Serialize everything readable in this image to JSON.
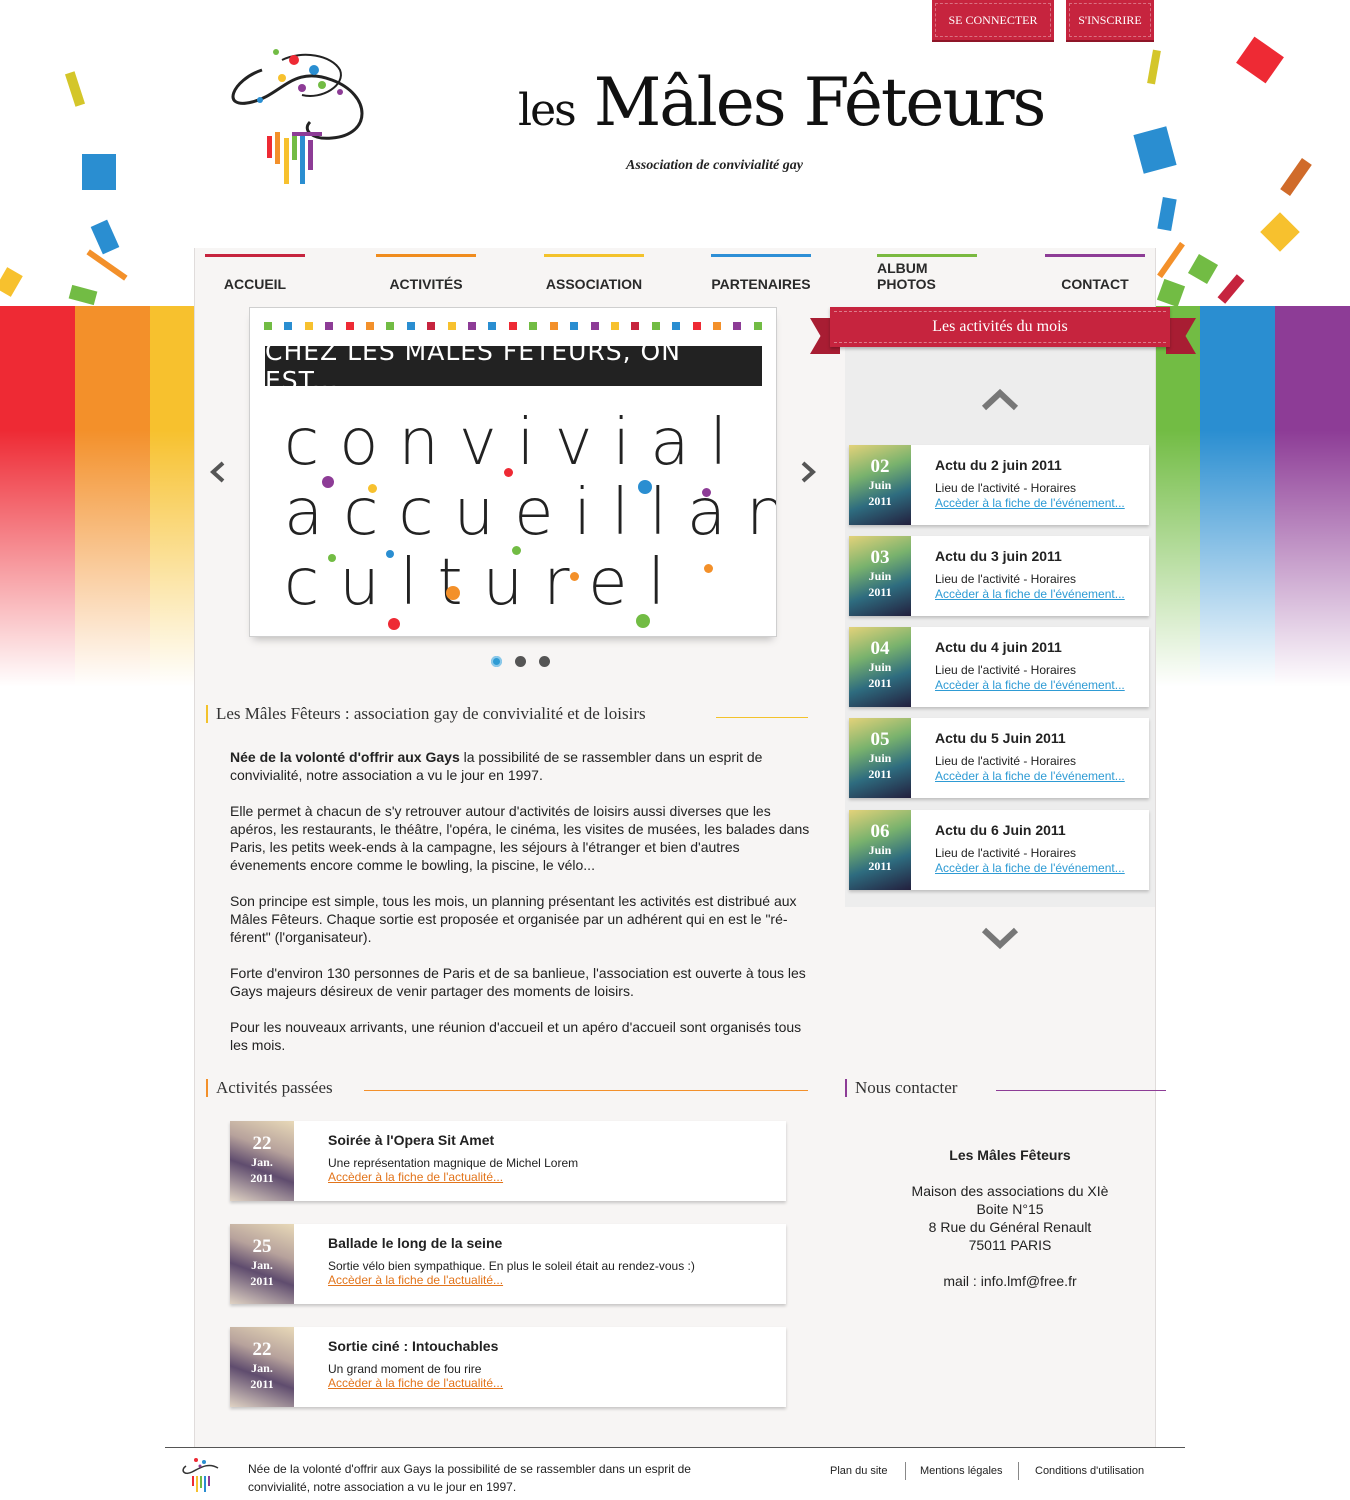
{
  "auth": {
    "login_label": "SE CONNECTER",
    "signup_label": "S'INSCRIRE"
  },
  "brand": {
    "name_les": "les",
    "name_rest": "Mâles Fêteurs",
    "tagline": "Association de convivialité gay"
  },
  "nav": [
    {
      "label": "ACCUEIL",
      "color": "#c6243e"
    },
    {
      "label": "ACTIVITÉS",
      "color": "#f08c1e"
    },
    {
      "label": "ASSOCIATION",
      "color": "#f3c22b"
    },
    {
      "label": "PARTENAIRES",
      "color": "#2e8fd6"
    },
    {
      "label": "ALBUM PHOTOS",
      "color": "#7ab940"
    },
    {
      "label": "CONTACT",
      "color": "#8d3c96"
    }
  ],
  "colors": {
    "stripes": [
      "#ee2a34",
      "#f3902a",
      "#f7c12e",
      "#ffffff",
      "#ffffff",
      "#ffffff",
      "#ffffff",
      "#ffffff",
      "#ffffff",
      "#ffffff",
      "#ffffff",
      "#ffffff",
      "#ffffff",
      "#ffffff",
      "#ffffff",
      "#72bc44",
      "#2a8ed1",
      "#8d3c96"
    ],
    "accent_red": "#c6243e",
    "link_blue": "#2e9bd4",
    "link_orange": "#e2741b"
  },
  "slider": {
    "headline": "CHEZ LES MÂLES FÊTEURS, ON EST...",
    "words": [
      "convivial",
      "accueillant",
      "culturel"
    ],
    "prev_icon": "chevron-left-icon",
    "next_icon": "chevron-right-icon",
    "pages": 3,
    "active_page": 1
  },
  "intro": {
    "title": "Les Mâles Fêteurs : association gay de convivialité et de loisirs",
    "p1_bold": "Née de la volonté d'offrir aux Gays",
    "p1_rest": " la possibilité de se rassembler dans un esprit de convivialité, notre association a vu le jour en 1997.",
    "p2": "Elle permet à chacun de s'y retrouver autour d'activités de loisirs aussi diverses que les apéros, les restaurants, le théâtre, l'opéra, le cinéma, les visites de musées, les balades dans Paris, les petits week-ends à la campagne, les séjours à l'étranger et bien d'autres évenements encore comme le bowling, la piscine, le vélo...",
    "p3": "Son principe est simple, tous les mois, un planning présentant les activités est distribué aux Mâles Fêteurs. Chaque sortie est proposée et organisée par un adhérent qui en est le \"ré-férent\" (l'organisateur).",
    "p4": "Forte d'environ 130 personnes de Paris et de sa banlieue, l'association est ouverte à tous les Gays majeurs désireux de venir partager des moments de loisirs.",
    "p5": "Pour les nouveaux arrivants, une réunion d'accueil et un apéro d'accueil sont organisés tous les mois."
  },
  "month": {
    "title": "Les activités du mois",
    "events": [
      {
        "day": "02",
        "month": "Juin",
        "year": "2011",
        "title": "Actu du 2 juin 2011",
        "sub": "Lieu de l'activité - Horaires",
        "link": "Accèder à la fiche de l'événement..."
      },
      {
        "day": "03",
        "month": "Juin",
        "year": "2011",
        "title": "Actu du 3 juin 2011",
        "sub": "Lieu de l'activité - Horaires",
        "link": "Accèder à la fiche de l'événement..."
      },
      {
        "day": "04",
        "month": "Juin",
        "year": "2011",
        "title": "Actu du 4 juin 2011",
        "sub": "Lieu de l'activité - Horaires",
        "link": "Accèder à la fiche de l'événement..."
      },
      {
        "day": "05",
        "month": "Juin",
        "year": "2011",
        "title": "Actu du 5 Juin 2011",
        "sub": "Lieu de l'activité - Horaires",
        "link": "Accèder à la fiche de l'événement..."
      },
      {
        "day": "06",
        "month": "Juin",
        "year": "2011",
        "title": "Actu du 6 Juin 2011",
        "sub": "Lieu de l'activité - Horaires",
        "link": "Accèder à la fiche de l'événement..."
      }
    ]
  },
  "past": {
    "title": "Activités passées",
    "items": [
      {
        "day": "22",
        "month": "Jan.",
        "year": "2011",
        "title": "Soirée à l'Opera Sit Amet",
        "sub": "Une représentation magnique de Michel Lorem",
        "link": "Accèder à la fiche de l'actualité..."
      },
      {
        "day": "25",
        "month": "Jan.",
        "year": "2011",
        "title": "Ballade le long de la seine",
        "sub": "Sortie vélo bien sympathique. En plus le soleil était au rendez-vous :)",
        "link": "Accèder à la fiche de l'actualité..."
      },
      {
        "day": "22",
        "month": "Jan.",
        "year": "2011",
        "title": "Sortie ciné : Intouchables",
        "sub": "Un grand moment de fou rire",
        "link": "Accèder à la fiche de l'actualité..."
      }
    ]
  },
  "contact": {
    "title": "Nous contacter",
    "name": "Les Mâles Fêteurs",
    "line1": "Maison des associations du XIè",
    "line2": "Boite N°15",
    "line3": "8 Rue du Général Renault",
    "line4": "75011 PARIS",
    "mail": "mail : info.lmf@free.fr"
  },
  "footer": {
    "text": "Née de la volonté d'offrir aux Gays la possibilité de se rassembler dans un esprit de convivialité, notre association a vu le jour en 1997.",
    "links": [
      "Plan du site",
      "Mentions légales",
      "Conditions d'utilisation"
    ]
  }
}
